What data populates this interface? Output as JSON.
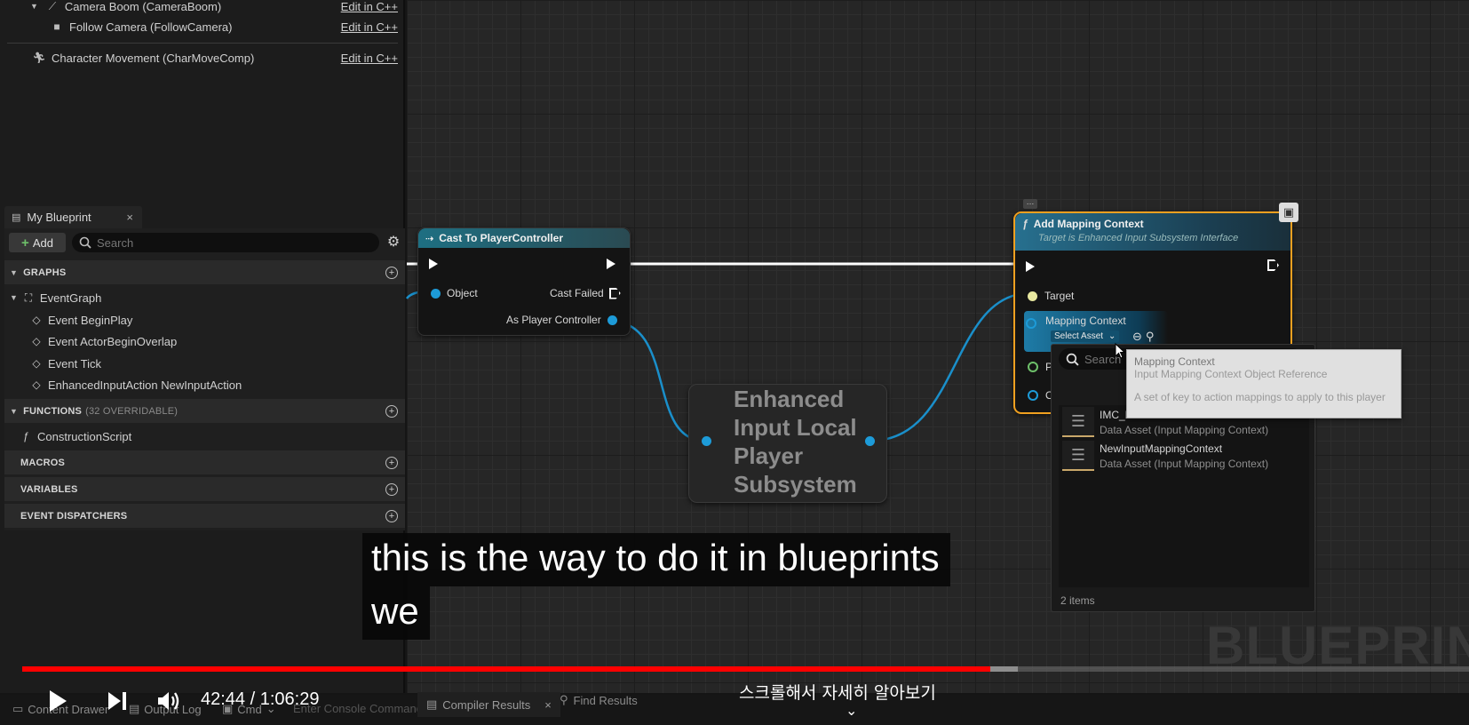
{
  "components": {
    "rows": [
      {
        "label": "Camera Boom (CameraBoom)",
        "edit": "Edit in C++"
      },
      {
        "label": "Follow Camera (FollowCamera)",
        "edit": "Edit in C++"
      },
      {
        "label": "Character Movement (CharMoveComp)",
        "edit": "Edit in C++"
      }
    ]
  },
  "my_blueprint": {
    "tab_label": "My Blueprint",
    "close": "×",
    "add_label": "Add",
    "search_placeholder": "Search",
    "sections": {
      "graphs": "GRAPHS",
      "functions": "FUNCTIONS",
      "functions_sub": "(32 OVERRIDABLE)",
      "macros": "MACROS",
      "variables": "VARIABLES",
      "dispatchers": "EVENT DISPATCHERS"
    },
    "graph_items": {
      "event_graph": "EventGraph",
      "events": [
        "Event BeginPlay",
        "Event ActorBeginOverlap",
        "Event Tick",
        "EnhancedInputAction NewInputAction"
      ]
    },
    "function_items": [
      "ConstructionScript"
    ]
  },
  "nodes": {
    "cast": {
      "title": "Cast To PlayerController",
      "object_pin": "Object",
      "cast_failed_pin": "Cast Failed",
      "as_pc_pin": "As Player Controller"
    },
    "eils": {
      "title": "Enhanced Input Local Player Subsystem"
    },
    "amc": {
      "title": "Add Mapping Context",
      "subtitle": "Target is Enhanced Input Subsystem Interface",
      "target_pin": "Target",
      "mapping_context_pin": "Mapping Context",
      "select_asset": "Select Asset",
      "p_pin": "P",
      "o_pin": "O"
    }
  },
  "picker": {
    "search_placeholder": "Search",
    "items": [
      {
        "name": "IMC_Default",
        "type": "Data Asset (Input Mapping Context)"
      },
      {
        "name": "NewInputMappingContext",
        "type": "Data Asset (Input Mapping Context)"
      }
    ],
    "count": "2 items"
  },
  "tooltip": {
    "line1": "Mapping Context",
    "line2": "Input Mapping Context Object Reference",
    "line3": "A set of key to action mappings to apply to this player"
  },
  "caption": {
    "line1": "this is the way to do it in blueprints",
    "line2": "we"
  },
  "watermark": "BLUEPRINT",
  "ue_bottom": {
    "content_drawer": "Content Drawer",
    "output_log": "Output Log",
    "cmd": "Cmd",
    "console_placeholder": "Enter Console Command",
    "compiler_results": "Compiler Results",
    "find_results": "Find Results"
  },
  "player": {
    "time": "42:44 / 1:06:29",
    "progress_played": 0.669,
    "progress_buffered": 0.688,
    "scroll_hint": "스크롤해서 자세히 알아보기"
  },
  "colors": {
    "accent_red": "#ff0000",
    "node_selected": "#f0a020",
    "object_pin": "#1d9bd8"
  }
}
